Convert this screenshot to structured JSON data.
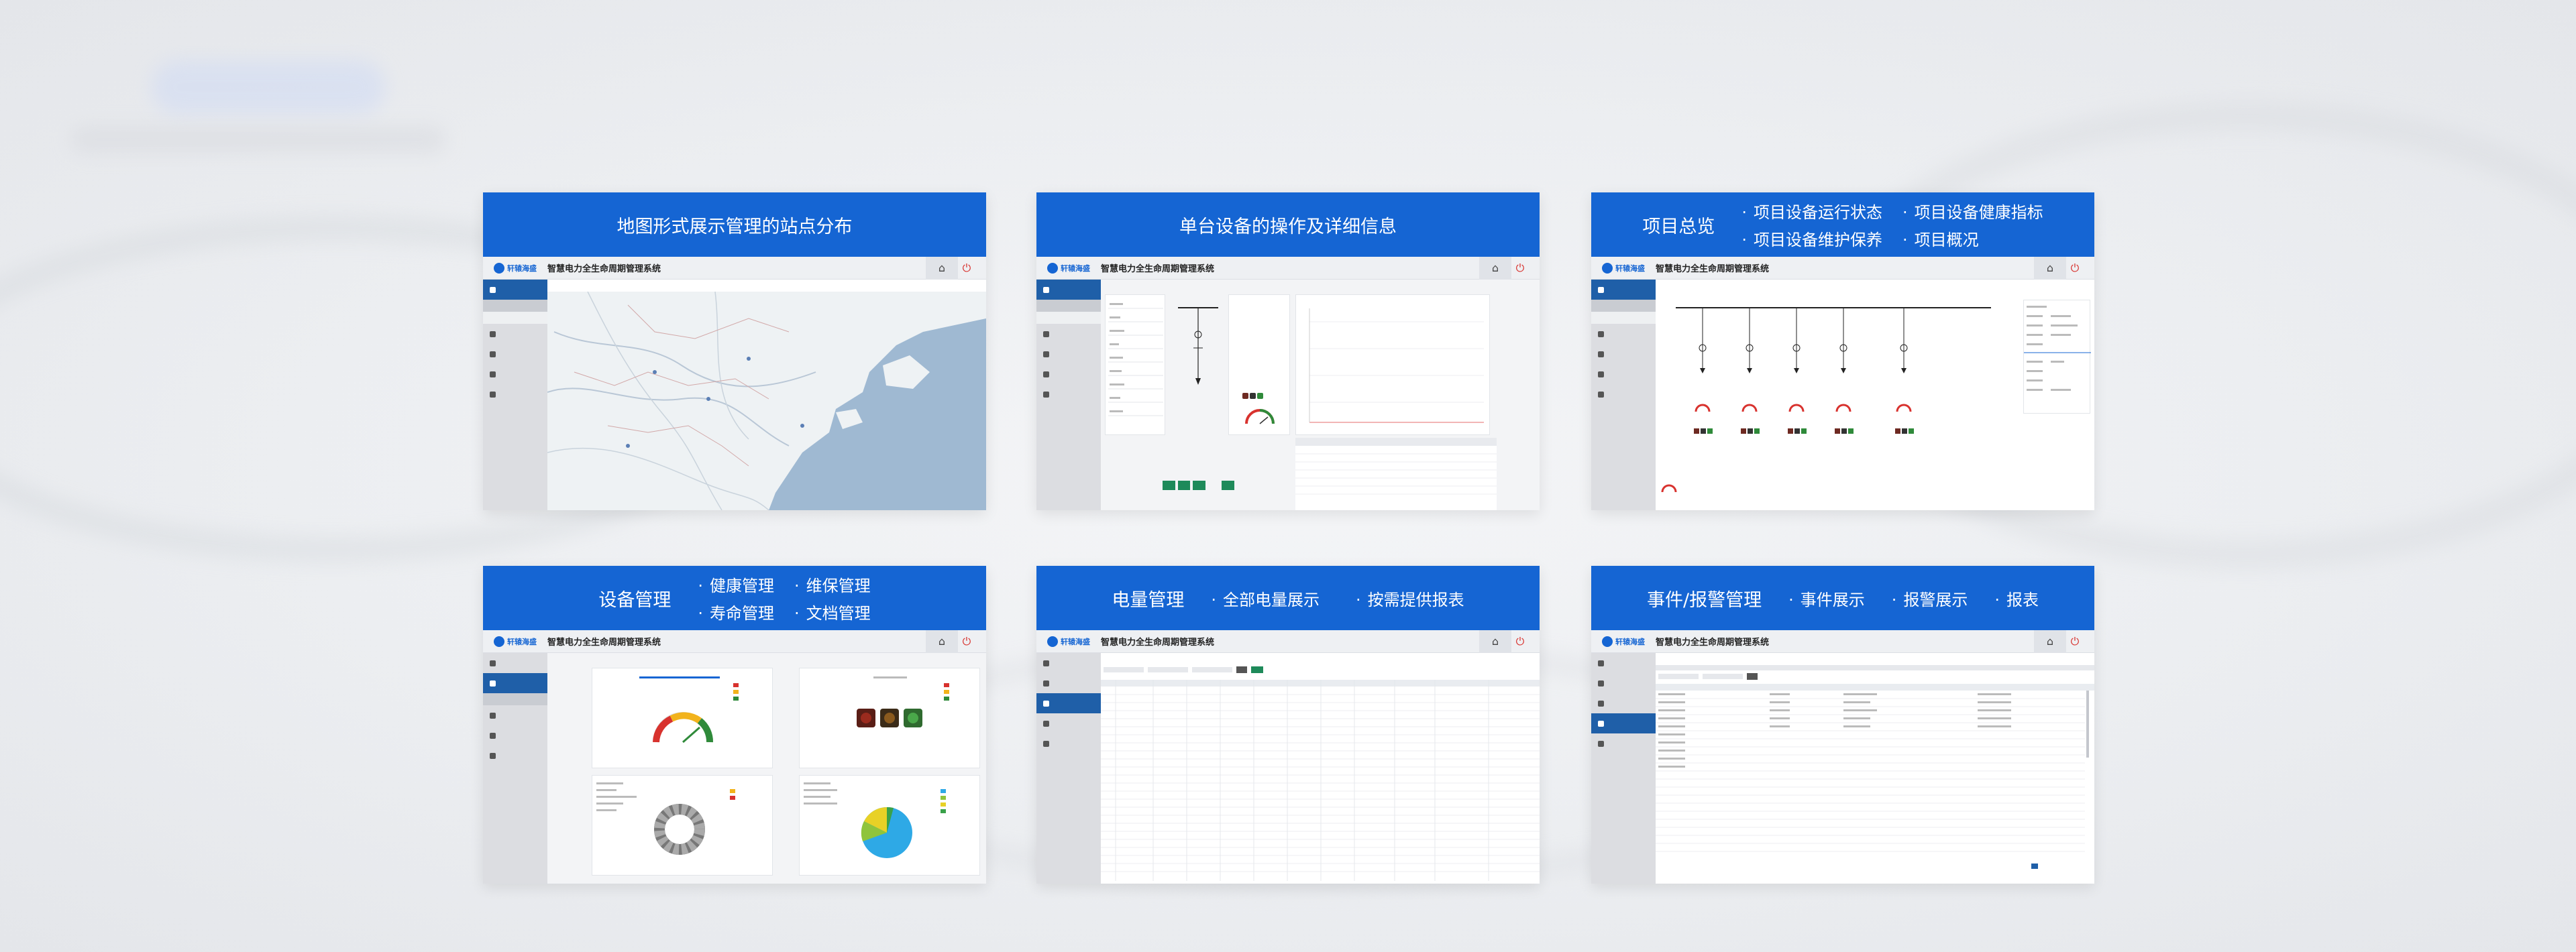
{
  "app": {
    "logo_text": "轩辕海盛",
    "system_title": "智慧电力全生命周期管理系统",
    "home_icon": "home-icon",
    "power_icon": "power-icon"
  },
  "cards": [
    {
      "title": "地图形式展示管理的站点分布",
      "features": []
    },
    {
      "title": "单台设备的操作及详细信息",
      "features": []
    },
    {
      "title": "项目总览",
      "features": [
        "项目设备运行状态",
        "项目设备健康指标",
        "项目设备维护保养",
        "项目概况"
      ]
    },
    {
      "title": "设备管理",
      "features": [
        "健康管理",
        "维保管理",
        "寿命管理",
        "文档管理"
      ]
    },
    {
      "title": "电量管理",
      "features": [
        "全部电量展示",
        "按需提供报表"
      ]
    },
    {
      "title": "事件/报警管理",
      "features": [
        "事件展示",
        "报警展示",
        "报表"
      ]
    }
  ],
  "colors": {
    "header_blue": "#1565d3",
    "sidebar_active": "#1f5fa8",
    "alarm_red": "#d8322e",
    "ok_green": "#1e8a5a"
  }
}
